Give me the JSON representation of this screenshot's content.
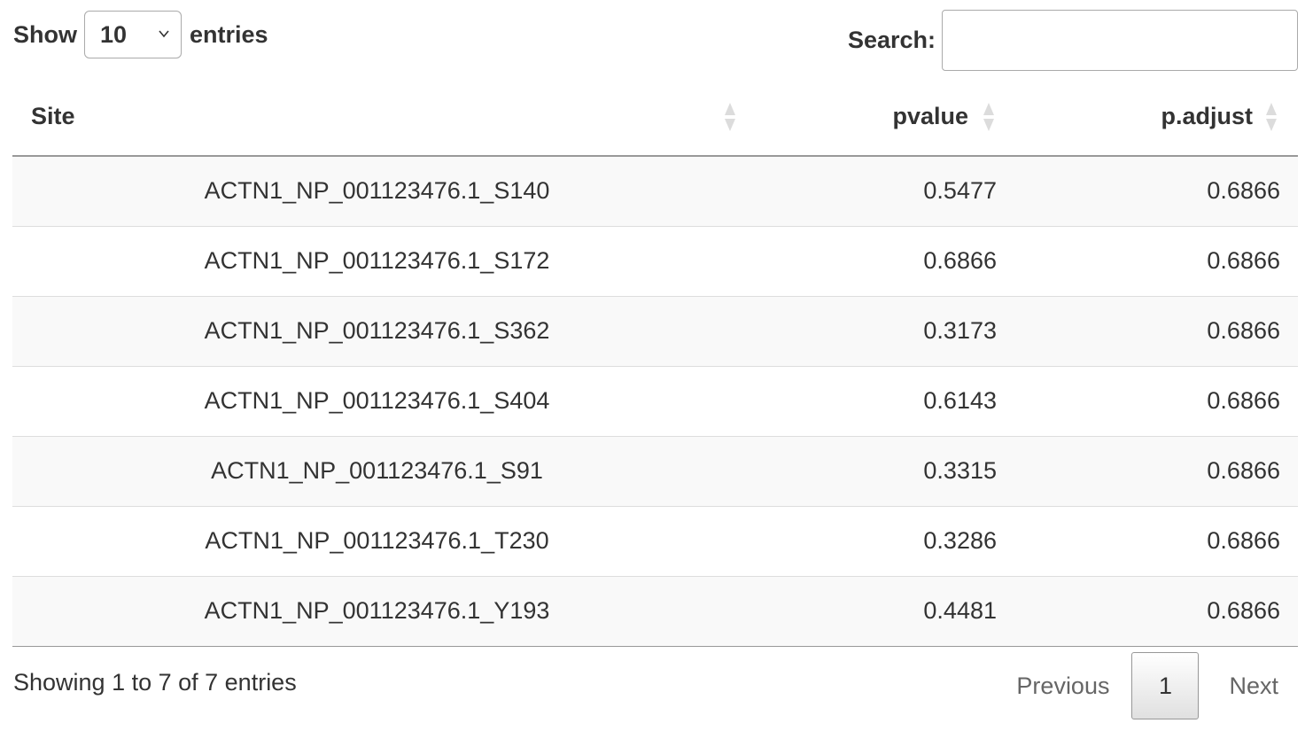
{
  "length_menu": {
    "show_label": "Show",
    "selected_value": "10",
    "entries_label": "entries"
  },
  "search": {
    "label": "Search:",
    "value": ""
  },
  "table": {
    "columns": [
      "Site",
      "pvalue",
      "p.adjust"
    ],
    "rows": [
      {
        "site": "ACTN1_NP_001123476.1_S140",
        "pvalue": "0.5477",
        "padjust": "0.6866"
      },
      {
        "site": "ACTN1_NP_001123476.1_S172",
        "pvalue": "0.6866",
        "padjust": "0.6866"
      },
      {
        "site": "ACTN1_NP_001123476.1_S362",
        "pvalue": "0.3173",
        "padjust": "0.6866"
      },
      {
        "site": "ACTN1_NP_001123476.1_S404",
        "pvalue": "0.6143",
        "padjust": "0.6866"
      },
      {
        "site": "ACTN1_NP_001123476.1_S91",
        "pvalue": "0.3315",
        "padjust": "0.6866"
      },
      {
        "site": "ACTN1_NP_001123476.1_T230",
        "pvalue": "0.3286",
        "padjust": "0.6866"
      },
      {
        "site": "ACTN1_NP_001123476.1_Y193",
        "pvalue": "0.4481",
        "padjust": "0.6866"
      }
    ]
  },
  "footer": {
    "info": "Showing 1 to 7 of 7 entries",
    "previous_label": "Previous",
    "current_page": "1",
    "next_label": "Next"
  },
  "icons": {
    "sort": "sort-both-icon",
    "dropdown": "chevron-down-icon"
  }
}
